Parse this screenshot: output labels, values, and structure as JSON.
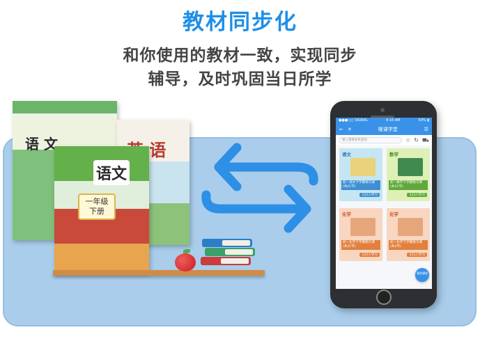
{
  "headline": "教材同步化",
  "subline1": "和你使用的教材一致，实现同步",
  "subline2": "辅导，及时巩固当日所学",
  "books": {
    "book1_title": "语 文",
    "book2_title": "英 语",
    "book3_title": "语文",
    "book3_grade_line1": "一年级",
    "book3_grade_line2": "下册"
  },
  "phone": {
    "status_left": "●●●○○ SIGNAL",
    "status_time": "9:16 AM",
    "status_right": "50% ▮",
    "nav_back_icon": "back-arrow-icon",
    "nav_close_icon": "close-icon",
    "nav_title": "微课学堂",
    "nav_menu_icon": "menu-icon",
    "search_placeholder": "输入需要名称查询",
    "toolbar_icons": [
      "star-icon",
      "refresh-icon",
      "cart-icon"
    ],
    "cards": [
      {
        "subject": "语文",
        "title": "初一语文下学期预习课(共21节)",
        "learners": "123人学习"
      },
      {
        "subject": "数学",
        "title": "初一数学下学期预习课(共21节)",
        "learners": "123人学习"
      },
      {
        "subject": "化学",
        "title": "初一化学下学期预习课(共21节)",
        "learners": "123人学习"
      },
      {
        "subject": "化学",
        "title": "初一化学下学期预习课(共2节)",
        "learners": "123人学习"
      }
    ],
    "fab_label": "我的课程"
  },
  "colors": {
    "headline": "#1e8fe8",
    "stage_bg": "#a9cdeb",
    "arrow": "#2d8fe6",
    "app_bar": "#3a92e8"
  }
}
